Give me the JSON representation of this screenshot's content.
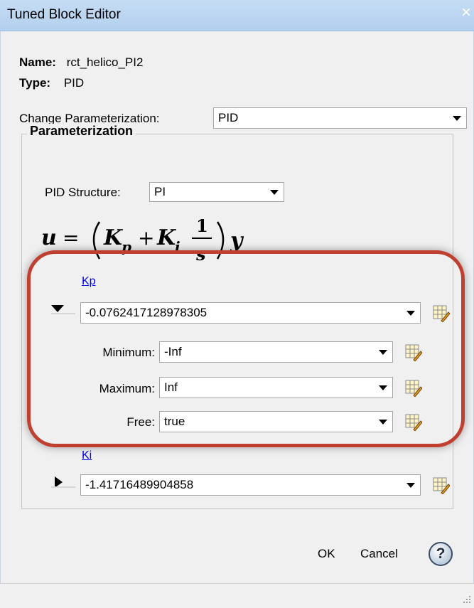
{
  "window": {
    "title": "Tuned Block Editor",
    "close_glyph": "×"
  },
  "info": {
    "name_label": "Name:",
    "name_value": "rct_helico_PI2",
    "type_label": "Type:",
    "type_value": "PID"
  },
  "change_param": {
    "label": "Change Parameterization:",
    "value": "PID"
  },
  "parameterization": {
    "legend": "Parameterization",
    "structure_label": "PID Structure:",
    "structure_value": "PI",
    "formula": "u = (Kp + Ki 1/s) y"
  },
  "kp": {
    "link": "Kp",
    "value": "-0.0762417128978305",
    "expanded": true,
    "minimum_label": "Minimum:",
    "minimum_value": "-Inf",
    "maximum_label": "Maximum:",
    "maximum_value": "Inf",
    "free_label": "Free:",
    "free_value": "true"
  },
  "ki": {
    "link": "Ki",
    "value": "-1.41716489904858",
    "expanded": false
  },
  "buttons": {
    "ok": "OK",
    "cancel": "Cancel",
    "help": "?"
  },
  "colors": {
    "highlight": "#bf3f31",
    "link": "#0000ee",
    "titlebar": "#b4d0ef"
  },
  "icons": [
    "close-icon",
    "dropdown-arrow-icon",
    "edit-table-icon",
    "expand-arrow-icon",
    "collapse-arrow-icon",
    "help-icon",
    "resize-grip-icon"
  ]
}
